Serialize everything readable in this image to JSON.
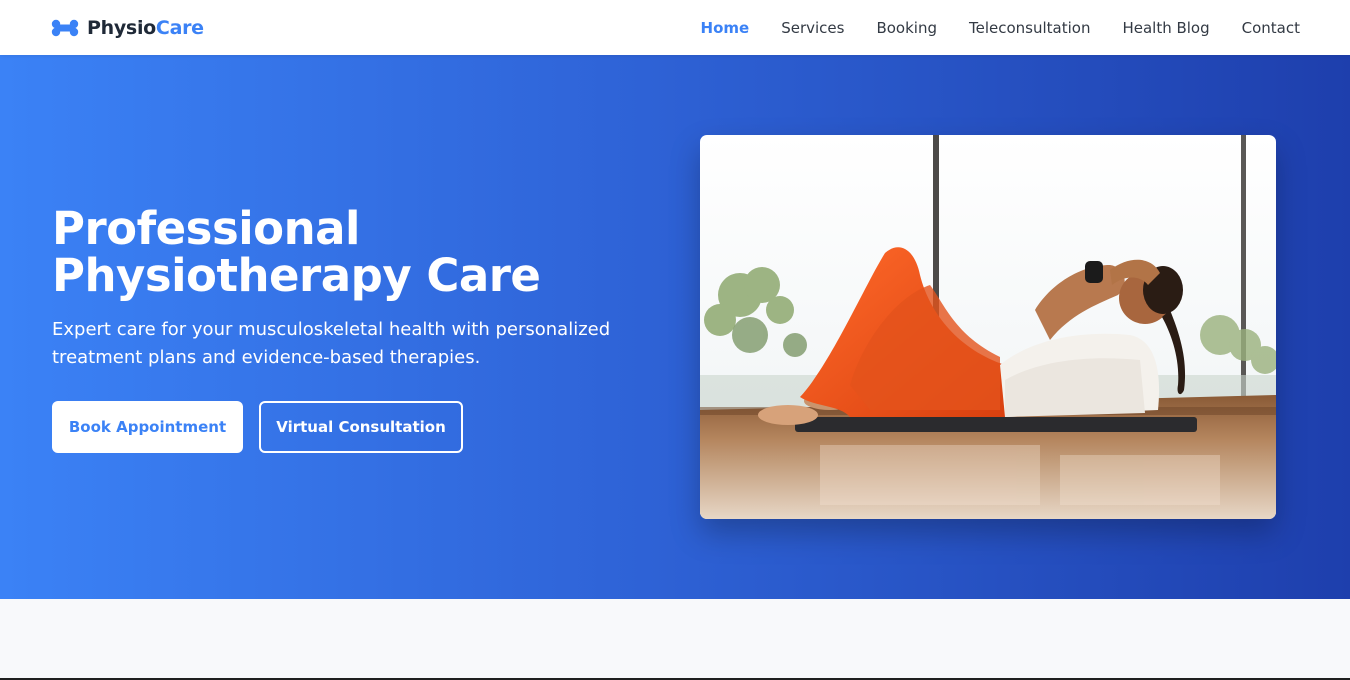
{
  "brand": {
    "name_part1": "Physio",
    "name_part2": "Care",
    "icon": "bone-icon"
  },
  "nav": {
    "items": [
      {
        "label": "Home",
        "active": true
      },
      {
        "label": "Services",
        "active": false
      },
      {
        "label": "Booking",
        "active": false
      },
      {
        "label": "Teleconsultation",
        "active": false
      },
      {
        "label": "Health Blog",
        "active": false
      },
      {
        "label": "Contact",
        "active": false
      }
    ]
  },
  "hero": {
    "title": "Professional Physiotherapy Care",
    "subtitle": "Expert care for your musculoskeletal health with personalized treatment plans and evidence-based therapies.",
    "primary_button": "Book Appointment",
    "secondary_button": "Virtual Consultation",
    "image_subject": "woman-doing-crunches-photo"
  },
  "colors": {
    "accent": "#3b82f6",
    "hero_gradient_start": "#3b82f6",
    "hero_gradient_end": "#1e3fad",
    "text_dark": "#333a44"
  }
}
